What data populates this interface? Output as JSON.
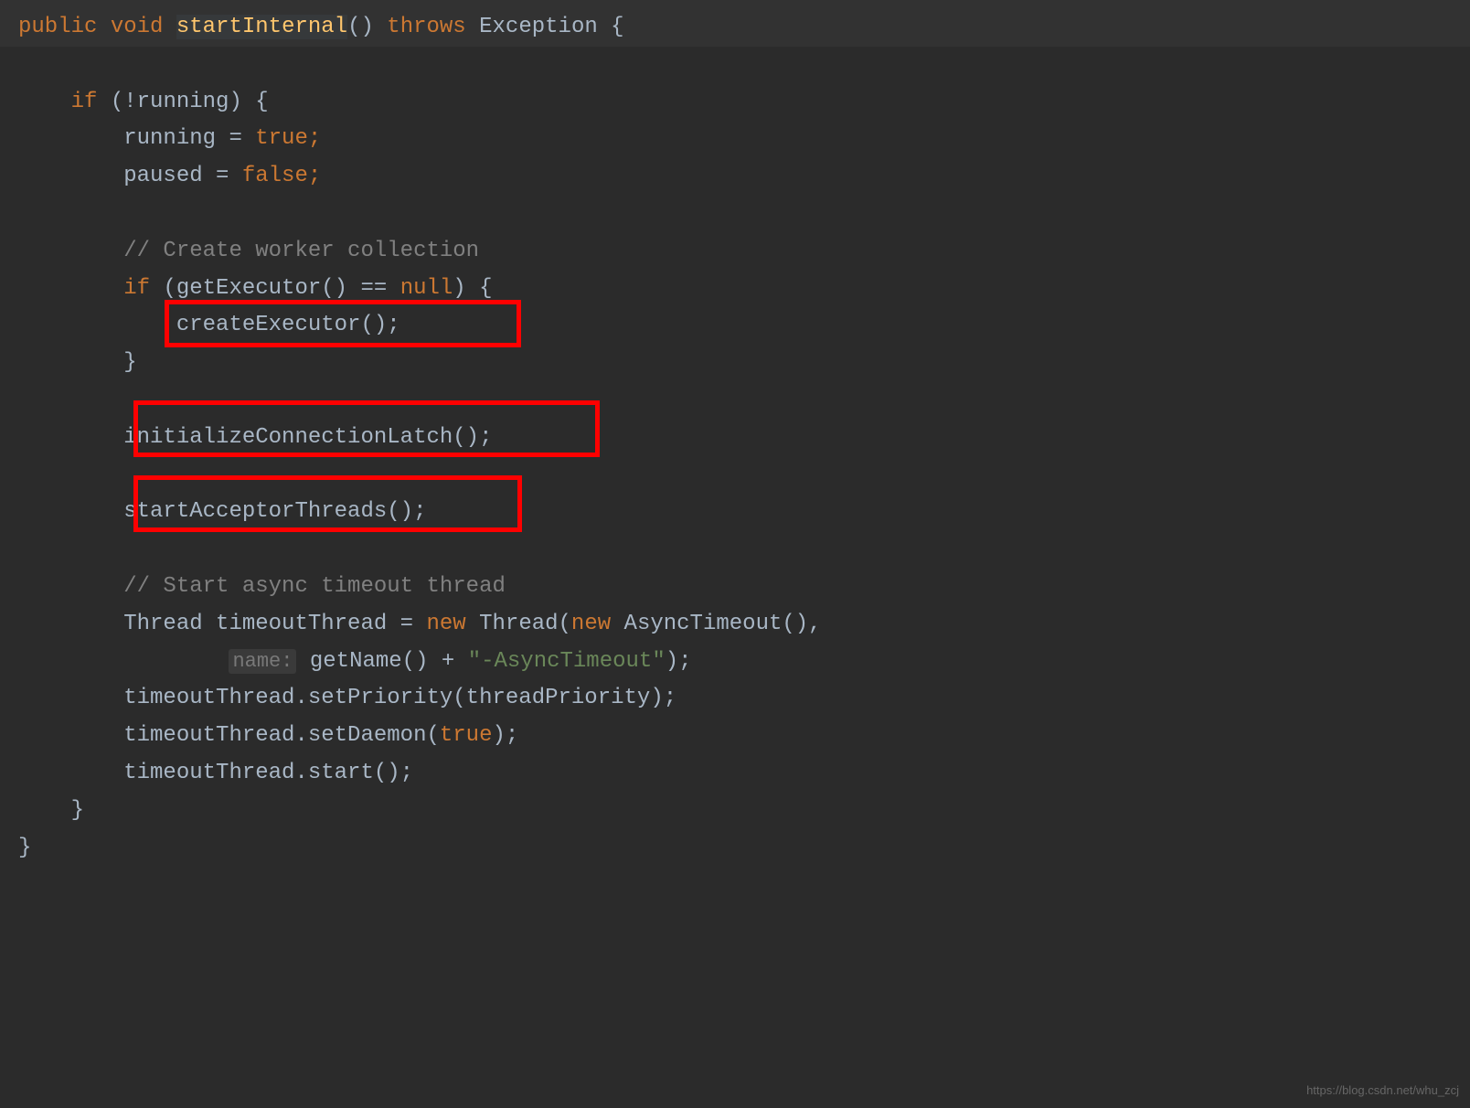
{
  "code": {
    "line1": {
      "public": "public",
      "void": "void",
      "methodName": "startInternal",
      "parens": "()",
      "throws": "throws",
      "exception": "Exception",
      "brace": "{"
    },
    "line3": {
      "if": "if",
      "condition": "(!running)",
      "brace": "{"
    },
    "line4": "running = ",
    "line4_true": "true",
    "line4_semi": ";",
    "line5": "paused = ",
    "line5_false": "false",
    "line5_semi": ";",
    "line7_comment": "// Create worker collection",
    "line8_if": "if",
    "line8_call": "(getExecutor() == ",
    "line8_null": "null",
    "line8_rest": ") {",
    "line9_call": "createExecutor();",
    "line10_brace": "}",
    "line12_call": "initializeConnectionLatch();",
    "line14_call": "startAcceptorThreads();",
    "line16_comment": "// Start async timeout thread",
    "line17_thread": "Thread timeoutThread = ",
    "line17_new1": "new",
    "line17_mid": " Thread(",
    "line17_new2": "new",
    "line17_end": " AsyncTimeout(),",
    "line18_hint": "name:",
    "line18_call": " getName() + ",
    "line18_string": "\"-AsyncTimeout\"",
    "line18_end": ");",
    "line19": "timeoutThread.setPriority(threadPriority);",
    "line20_a": "timeoutThread.setDaemon(",
    "line20_true": "true",
    "line20_b": ");",
    "line21": "timeoutThread.start();",
    "line22_brace": "}",
    "line23_brace": "}"
  },
  "watermark": "https://blog.csdn.net/whu_zcj"
}
